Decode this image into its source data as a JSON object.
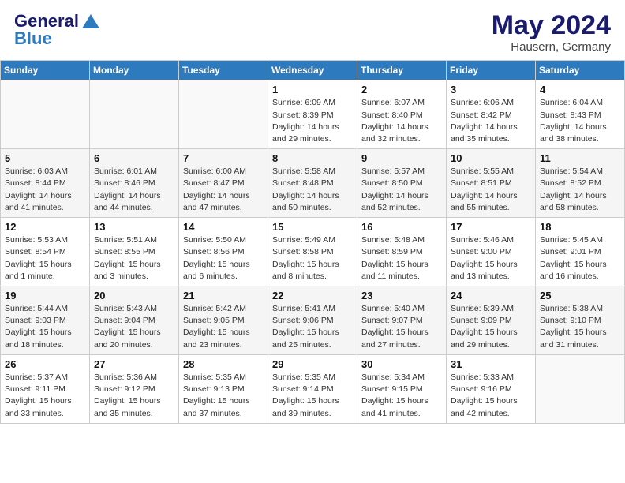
{
  "header": {
    "logo_line1": "General",
    "logo_line2": "Blue",
    "calendar_title": "May 2024",
    "calendar_subtitle": "Hausern, Germany"
  },
  "weekdays": [
    "Sunday",
    "Monday",
    "Tuesday",
    "Wednesday",
    "Thursday",
    "Friday",
    "Saturday"
  ],
  "weeks": [
    [
      {
        "day": "",
        "info": ""
      },
      {
        "day": "",
        "info": ""
      },
      {
        "day": "",
        "info": ""
      },
      {
        "day": "1",
        "info": "Sunrise: 6:09 AM\nSunset: 8:39 PM\nDaylight: 14 hours\nand 29 minutes."
      },
      {
        "day": "2",
        "info": "Sunrise: 6:07 AM\nSunset: 8:40 PM\nDaylight: 14 hours\nand 32 minutes."
      },
      {
        "day": "3",
        "info": "Sunrise: 6:06 AM\nSunset: 8:42 PM\nDaylight: 14 hours\nand 35 minutes."
      },
      {
        "day": "4",
        "info": "Sunrise: 6:04 AM\nSunset: 8:43 PM\nDaylight: 14 hours\nand 38 minutes."
      }
    ],
    [
      {
        "day": "5",
        "info": "Sunrise: 6:03 AM\nSunset: 8:44 PM\nDaylight: 14 hours\nand 41 minutes."
      },
      {
        "day": "6",
        "info": "Sunrise: 6:01 AM\nSunset: 8:46 PM\nDaylight: 14 hours\nand 44 minutes."
      },
      {
        "day": "7",
        "info": "Sunrise: 6:00 AM\nSunset: 8:47 PM\nDaylight: 14 hours\nand 47 minutes."
      },
      {
        "day": "8",
        "info": "Sunrise: 5:58 AM\nSunset: 8:48 PM\nDaylight: 14 hours\nand 50 minutes."
      },
      {
        "day": "9",
        "info": "Sunrise: 5:57 AM\nSunset: 8:50 PM\nDaylight: 14 hours\nand 52 minutes."
      },
      {
        "day": "10",
        "info": "Sunrise: 5:55 AM\nSunset: 8:51 PM\nDaylight: 14 hours\nand 55 minutes."
      },
      {
        "day": "11",
        "info": "Sunrise: 5:54 AM\nSunset: 8:52 PM\nDaylight: 14 hours\nand 58 minutes."
      }
    ],
    [
      {
        "day": "12",
        "info": "Sunrise: 5:53 AM\nSunset: 8:54 PM\nDaylight: 15 hours\nand 1 minute."
      },
      {
        "day": "13",
        "info": "Sunrise: 5:51 AM\nSunset: 8:55 PM\nDaylight: 15 hours\nand 3 minutes."
      },
      {
        "day": "14",
        "info": "Sunrise: 5:50 AM\nSunset: 8:56 PM\nDaylight: 15 hours\nand 6 minutes."
      },
      {
        "day": "15",
        "info": "Sunrise: 5:49 AM\nSunset: 8:58 PM\nDaylight: 15 hours\nand 8 minutes."
      },
      {
        "day": "16",
        "info": "Sunrise: 5:48 AM\nSunset: 8:59 PM\nDaylight: 15 hours\nand 11 minutes."
      },
      {
        "day": "17",
        "info": "Sunrise: 5:46 AM\nSunset: 9:00 PM\nDaylight: 15 hours\nand 13 minutes."
      },
      {
        "day": "18",
        "info": "Sunrise: 5:45 AM\nSunset: 9:01 PM\nDaylight: 15 hours\nand 16 minutes."
      }
    ],
    [
      {
        "day": "19",
        "info": "Sunrise: 5:44 AM\nSunset: 9:03 PM\nDaylight: 15 hours\nand 18 minutes."
      },
      {
        "day": "20",
        "info": "Sunrise: 5:43 AM\nSunset: 9:04 PM\nDaylight: 15 hours\nand 20 minutes."
      },
      {
        "day": "21",
        "info": "Sunrise: 5:42 AM\nSunset: 9:05 PM\nDaylight: 15 hours\nand 23 minutes."
      },
      {
        "day": "22",
        "info": "Sunrise: 5:41 AM\nSunset: 9:06 PM\nDaylight: 15 hours\nand 25 minutes."
      },
      {
        "day": "23",
        "info": "Sunrise: 5:40 AM\nSunset: 9:07 PM\nDaylight: 15 hours\nand 27 minutes."
      },
      {
        "day": "24",
        "info": "Sunrise: 5:39 AM\nSunset: 9:09 PM\nDaylight: 15 hours\nand 29 minutes."
      },
      {
        "day": "25",
        "info": "Sunrise: 5:38 AM\nSunset: 9:10 PM\nDaylight: 15 hours\nand 31 minutes."
      }
    ],
    [
      {
        "day": "26",
        "info": "Sunrise: 5:37 AM\nSunset: 9:11 PM\nDaylight: 15 hours\nand 33 minutes."
      },
      {
        "day": "27",
        "info": "Sunrise: 5:36 AM\nSunset: 9:12 PM\nDaylight: 15 hours\nand 35 minutes."
      },
      {
        "day": "28",
        "info": "Sunrise: 5:35 AM\nSunset: 9:13 PM\nDaylight: 15 hours\nand 37 minutes."
      },
      {
        "day": "29",
        "info": "Sunrise: 5:35 AM\nSunset: 9:14 PM\nDaylight: 15 hours\nand 39 minutes."
      },
      {
        "day": "30",
        "info": "Sunrise: 5:34 AM\nSunset: 9:15 PM\nDaylight: 15 hours\nand 41 minutes."
      },
      {
        "day": "31",
        "info": "Sunrise: 5:33 AM\nSunset: 9:16 PM\nDaylight: 15 hours\nand 42 minutes."
      },
      {
        "day": "",
        "info": ""
      }
    ]
  ]
}
